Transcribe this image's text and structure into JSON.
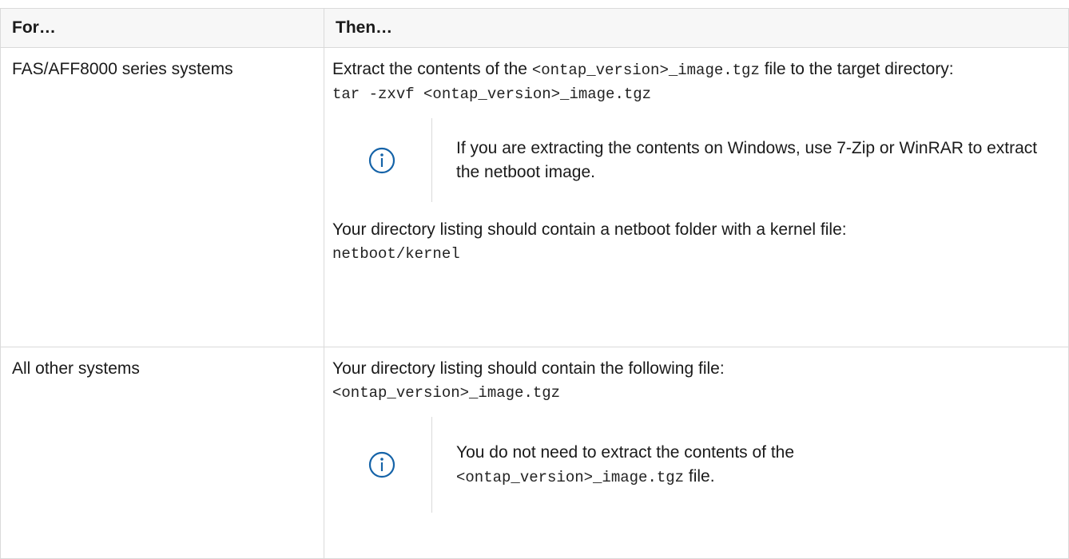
{
  "table": {
    "headers": [
      "For…",
      "Then…"
    ],
    "rows": [
      {
        "for": "FAS/AFF8000 series systems",
        "intro_pre": "Extract the contents of the ",
        "intro_code": "<ontap_version>_image.tgz",
        "intro_post": " file to the target directory:",
        "command": "tar -zxvf <ontap_version>_image.tgz",
        "note": "If you are extracting the contents on Windows, use 7-Zip or WinRAR to extract the netboot image.",
        "listing_text": "Your directory listing should contain a netboot folder with a kernel file:",
        "listing_code": "netboot/kernel"
      },
      {
        "for": "All other systems",
        "listing_text": "Your directory listing should contain the following file:",
        "listing_code": "<ontap_version>_image.tgz",
        "note_pre": "You do not need to extract the contents of the ",
        "note_code": "<ontap_version>_image.tgz",
        "note_post": " file."
      }
    ]
  },
  "icons": {
    "note_icon": "info-circle-icon",
    "accent_color": "#1563a8"
  }
}
